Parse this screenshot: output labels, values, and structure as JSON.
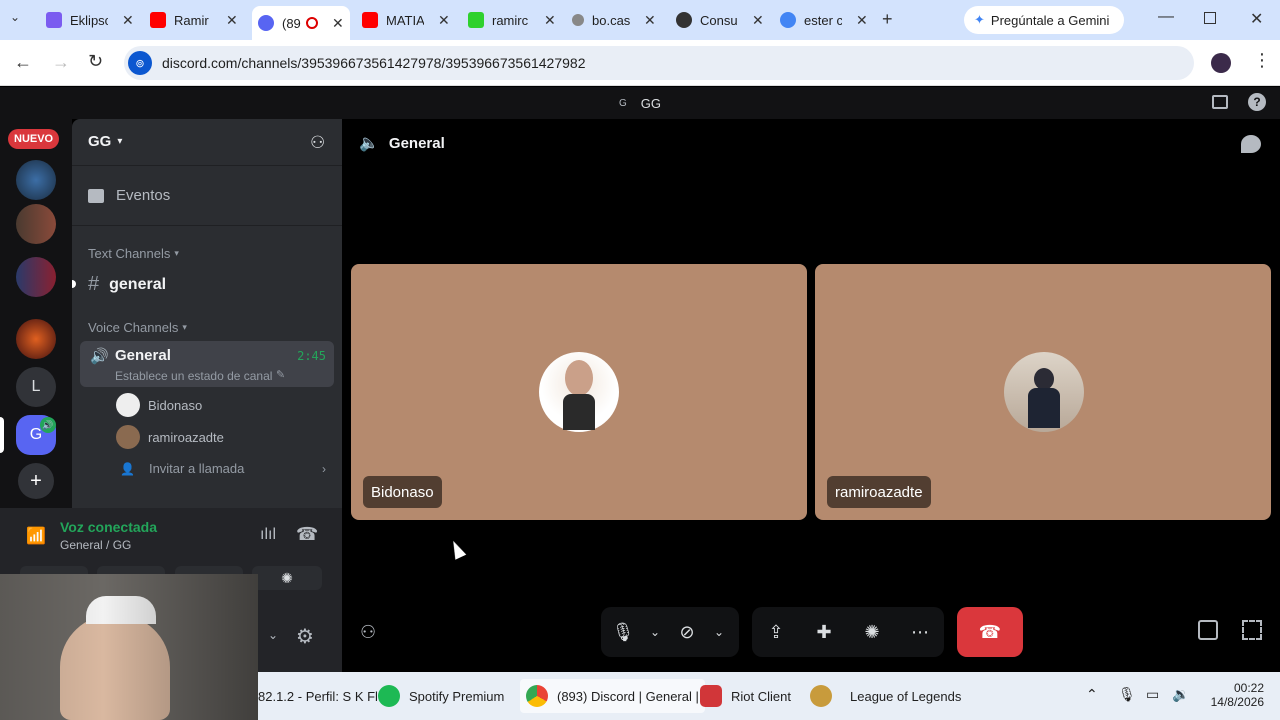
{
  "browser": {
    "tabs": [
      {
        "title": "Eklipsc",
        "color": "#7b5cf0"
      },
      {
        "title": "Ramir",
        "color": "#ff0000"
      },
      {
        "title": "(89",
        "color": "#5865f2"
      },
      {
        "title": "MATIA",
        "color": "#ff0000"
      },
      {
        "title": "ramirc",
        "color": "#2ed12e"
      },
      {
        "title": "bo.cas",
        "color": "#888888"
      },
      {
        "title": "Consu",
        "color": "#333333"
      },
      {
        "title": "ester c",
        "color": "#4285f4"
      }
    ],
    "gemini_label": "Pregúntale a Gemini",
    "url": "discord.com/channels/395396673561427978/395396673561427982"
  },
  "discord": {
    "top_title": "GG",
    "top_icon_letter": "G",
    "guilds": {
      "new_badge": "NUEVO",
      "letter_server": "L",
      "active_server": "G"
    },
    "server_name": "GG",
    "events_label": "Eventos",
    "text_channels_label": "Text Channels",
    "text_channel": "general",
    "voice_channels_label": "Voice Channels",
    "voice_channel": {
      "name": "General",
      "time": "2:45",
      "status_hint": "Establece un estado de canal"
    },
    "voice_members": [
      "Bidonaso",
      "ramiroazadte"
    ],
    "invite_label": "Invitar a llamada",
    "voice_status": {
      "title": "Voz conectada",
      "subtitle": "General / GG"
    },
    "main_header": "General",
    "tiles": [
      {
        "name": "Bidonaso"
      },
      {
        "name": "ramiroazadte"
      }
    ],
    "accent_green": "#23a55a",
    "danger_red": "#da373c"
  },
  "taskbar": {
    "items": [
      {
        "label": "82.1.2 - Perfil: S K Fl"
      },
      {
        "label": "Spotify Premium"
      },
      {
        "label": "(893) Discord | General |"
      },
      {
        "label": "Riot Client"
      },
      {
        "label": "League of Legends"
      }
    ],
    "time": "00:22",
    "date": "14/8/2026"
  }
}
